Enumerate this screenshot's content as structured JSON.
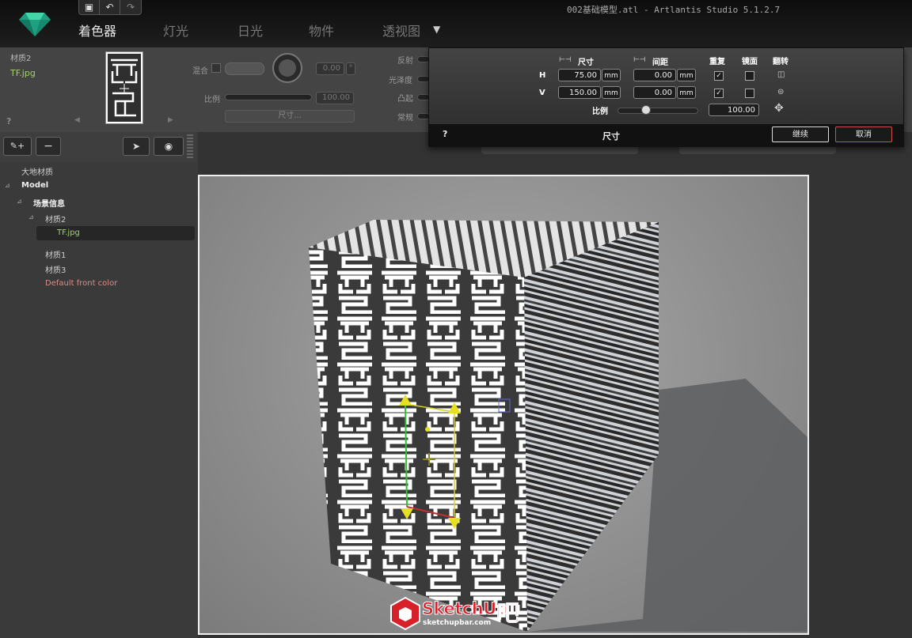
{
  "window": {
    "title": "002基础模型.atl - Artlantis Studio 5.1.2.7"
  },
  "toolbar": {
    "save_icon": "save-icon",
    "undo_icon": "undo-icon",
    "redo_icon": "redo-icon"
  },
  "tabs": [
    {
      "label": "着色器"
    },
    {
      "label": "灯光"
    },
    {
      "label": "日光"
    },
    {
      "label": "物件"
    },
    {
      "label": "透视图"
    }
  ],
  "shader": {
    "material_name": "材质2",
    "texture_name": "TF.jpg",
    "help": "?",
    "blend_label": "混合",
    "angle_value": "0.00",
    "angle_unit": "°",
    "scale_label": "比例",
    "scale_value": "100.00",
    "size_button": "尺寸...",
    "reflect_label": "反射",
    "gloss_label": "光泽度",
    "bump_label": "凸起",
    "normal_label": "常规"
  },
  "sidebar": {
    "tree": [
      {
        "label": "大地材质",
        "level": 0,
        "bold": false
      },
      {
        "label": "Model",
        "level": 0,
        "bold": true
      },
      {
        "label": "场景信息",
        "level": 1,
        "bold": true
      },
      {
        "label": "材质2",
        "level": 2,
        "bold": false
      },
      {
        "label": "TF.jpg",
        "level": 3,
        "selected": true
      },
      {
        "label": "材质1",
        "level": 2
      },
      {
        "label": "材质3",
        "level": 2
      },
      {
        "label": "Default front color",
        "level": 2
      }
    ]
  },
  "dialog": {
    "title": "尺寸",
    "help": "?",
    "size_header": "尺寸",
    "spacing_header": "间距",
    "repeat_header": "重复",
    "mirror_header": "镜面",
    "flip_header": "翻转",
    "h_label": "H",
    "v_label": "V",
    "h_size": "75.00",
    "v_size": "150.00",
    "h_spacing": "0.00",
    "v_spacing": "0.00",
    "unit": "mm",
    "repeat_h": true,
    "repeat_v": true,
    "mirror_h": false,
    "mirror_v": false,
    "scale_label": "比例",
    "scale_value": "100.00",
    "continue_button": "继续",
    "cancel_button": "取消"
  },
  "watermark": {
    "brand": "SketchUp",
    "suffix": "吧",
    "url": "sketchupbar.com"
  },
  "colors": {
    "accent_green": "#9fd36a",
    "default_color_text": "#e08a8a",
    "cancel_border": "#d05050"
  }
}
